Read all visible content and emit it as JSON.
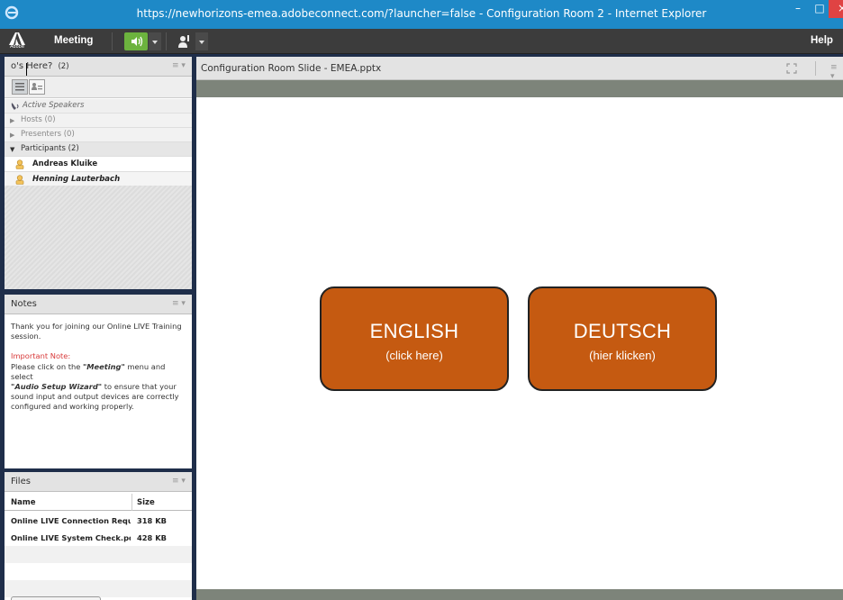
{
  "window": {
    "title": "https://newhorizons-emea.adobeconnect.com/?launcher=false - Configuration Room 2 - Internet Explorer",
    "minimize": "–",
    "maximize": "□",
    "close": "×"
  },
  "menubar": {
    "logo_text": "Adobe",
    "meeting": "Meeting",
    "help": "Help"
  },
  "attendees": {
    "title": "o's Here?",
    "count": "(2)",
    "menu": "≡ ▾",
    "active_speakers": "Active Speakers",
    "hosts": "Hosts (0)",
    "presenters": "Presenters (0)",
    "participants": "Participants (2)",
    "people": [
      "Andreas Kluike",
      "Henning Lauterbach"
    ]
  },
  "notes": {
    "title": "Notes",
    "menu": "≡ ▾",
    "intro": "Thank you for joining our Online LIVE Training session.",
    "important_label": "Important Note:",
    "line1_pre": "Please click on the ",
    "line1_em": "\"Meeting\"",
    "line1_post": " menu and select",
    "line2_em": "\"Audio Setup Wizard\"",
    "line2_post": " to ensure that your sound input and output devices are correctly configured and working properly."
  },
  "files": {
    "title": "Files",
    "menu": "≡ ▾",
    "col_name": "Name",
    "col_size": "Size",
    "rows": [
      {
        "name": "Online LIVE Connection Requirements",
        "size": "318 KB"
      },
      {
        "name": "Online LIVE System Check.pdf",
        "size": "428 KB"
      }
    ]
  },
  "main": {
    "title": "Configuration Room Slide - EMEA.pptx",
    "menu": "≡ ▾",
    "buttons": [
      {
        "label": "ENGLISH",
        "sub": "(click here)"
      },
      {
        "label": "DEUTSCH",
        "sub": "(hier klicken)"
      }
    ],
    "button_color": "#c55a11"
  },
  "colors": {
    "titlebar": "#1e89c7",
    "menubar": "#3c3c3c",
    "audio_active": "#6cb33e",
    "frame": "#1f2e4a"
  }
}
